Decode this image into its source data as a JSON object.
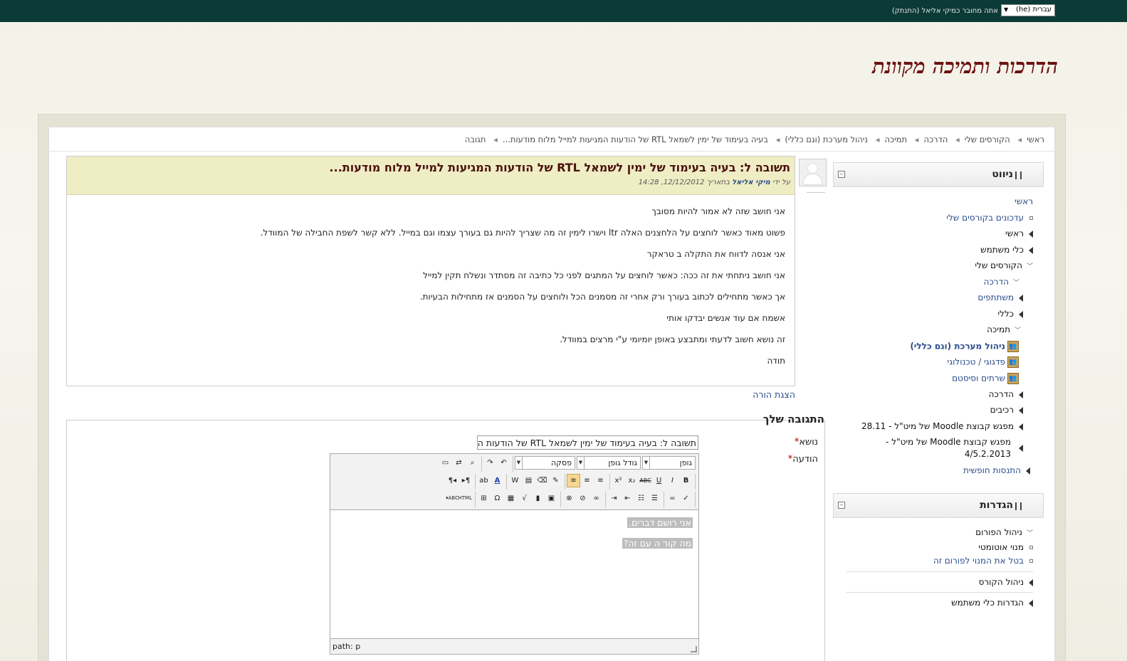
{
  "topbar": {
    "login_text": "אתה מחובר כמיקי אליאל (התנתק)",
    "language": "עברית (he)"
  },
  "site_title": "הדרכות ותמיכה מקוונת",
  "breadcrumb": [
    "ראשי",
    "הקורסים שלי",
    "הדרכה",
    "תמיכה",
    "ניהול מערכת (וגם כללי)",
    "בעיה בעימוד של ימין לשמאל RTL של הודעות המגיעות למייל מלוח מודעות...",
    "תגובה"
  ],
  "navigation": {
    "title": "ניווט",
    "items": [
      "ראשי",
      "עדכונים בקורסים שלי",
      "ראשי",
      "כלי משתמש",
      "הקורסים שלי",
      "הדרכה",
      "משתתפים",
      "כללי",
      "תמיכה",
      "ניהול מערכת (וגם כללי)",
      "פדגוגי / טכנולוגי",
      "שרתים וסיסטם",
      "הדרכה",
      "רכיבים",
      "מפגש קבוצת Moodle של מיט\"ל - 28.11",
      "מפגש קבוצת Moodle של מיט\"ל -",
      "4/5.2.2013",
      "התנסות חופשית"
    ]
  },
  "settings": {
    "title": "הגדרות",
    "items": [
      "ניהול הפורום",
      "מנוי אוטומטי",
      "בטל את המנוי לפורום זה",
      "ניהול הקורס",
      "הגדרות כלי משתמש"
    ]
  },
  "post": {
    "title": "תשובה ל: בעיה בעימוד של ימין לשמאל RTL של הודעות המגיעות למייל מלוח מודעות...",
    "meta_prefix": "על ידי",
    "author": "מיקי אליאל",
    "meta_date": "בתאריך 12/12/2012, 14:28",
    "paragraphs": [
      "אני חושב שזה לא אמור להיות מסובך",
      "פשוט מאוד כאשר לוחצים על הלחצנים האלה ltr וישרו לימין זה מה שצריך להיות גם בעורך עצמו וגם במייל. ללא קשר לשפת החבילה של המוודל.",
      "אני אנסה לדווח את התקלה ב טראקר",
      "אני חושב ניתחתי את זה ככה:  כאשר לוחצים על המתגים לפני כל כתיבה זה מסתדר ונשלח תקין למייל",
      "אך כאשר מתחילים לכתוב בעורך ורק אחרי זה מסמנים הכל ולוחצים על הסמנים אז מתחילות הבעיות.",
      "אשמח אם עוד אנשים יבדקו אותי",
      "זה נושא חשוב לדעתי ומתבצע באופן יומיומי ע\"י מרצים במוודל.",
      "תודה"
    ],
    "rate_link": "הצגת הורה"
  },
  "reply": {
    "title": "התגובה שלך",
    "subject_label": "נושא",
    "subject_value": "תשובה ל: בעיה בעימוד של ימין לשמאל RTL של הודעות המגיעות למייל",
    "message_label": "הודעה",
    "editor": {
      "font_family": "גופן",
      "font_size": "גודל גופן",
      "format": "פסקה",
      "lines": [
        "אני רושם דברים.",
        "מה קור ה   עם  זה?"
      ],
      "path": "path: p"
    }
  }
}
